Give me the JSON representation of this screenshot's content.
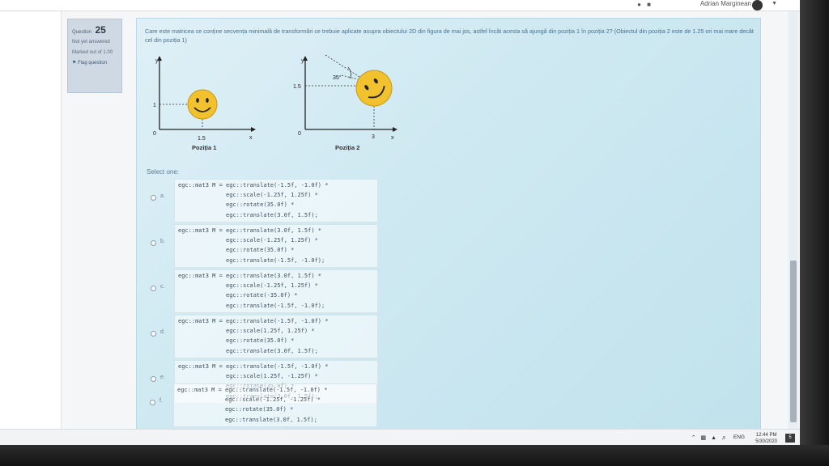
{
  "header": {
    "user_name": "Adrian Marginean"
  },
  "question_info": {
    "label": "Question",
    "number": "25",
    "status": "Not yet answered",
    "marked": "Marked out of 1.00",
    "flag": "Flag question"
  },
  "question": {
    "text": "Care este matricea ce conține secvența minimală de transformări ce trebuie aplicate asupra obiectului 2D din figura de mai jos, astfel încât acesta să ajungă din poziția 1 în poziția 2? (Obiectul din poziția 2 este de 1.25 ori mai mare decât cel din poziția 1)"
  },
  "figure1": {
    "y_axis": "y",
    "x_axis": "x",
    "origin": "0",
    "y_value": "1",
    "x_value": "1.5",
    "caption": "Poziția 1"
  },
  "figure2": {
    "y_axis": "y",
    "x_axis": "x",
    "origin": "0",
    "y_value": "1.5",
    "x_value": "3",
    "angle": "35°",
    "caption": "Poziția 2"
  },
  "select_label": "Select one:",
  "options": [
    {
      "label": "a.",
      "code": "egc::mat3 M = egc::translate(-1.5f, -1.0f) *\n              egc::scale(-1.25f, 1.25f) *\n              egc::rotate(35.0f) *\n              egc::translate(3.0f, 1.5f);"
    },
    {
      "label": "b.",
      "code": "egc::mat3 M = egc::translate(3.0f, 1.5f) *\n              egc::scale(-1.25f, 1.25f) *\n              egc::rotate(35.0f) *\n              egc::translate(-1.5f, -1.0f);"
    },
    {
      "label": "c.",
      "code": "egc::mat3 M = egc::translate(3.0f, 1.5f) *\n              egc::scale(-1.25f, 1.25f) *\n              egc::rotate(-35.0f) *\n              egc::translate(-1.5f, -1.0f);"
    },
    {
      "label": "d.",
      "code": "egc::mat3 M = egc::translate(-1.5f, -1.0f) *\n              egc::scale(1.25f, 1.25f) *\n              egc::rotate(35.0f) *\n              egc::translate(3.0f, 1.5f);"
    },
    {
      "label": "e.",
      "code": "egc::mat3 M = egc::translate(-1.5f, -1.0f) *\n              egc::scale(1.25f, -1.25f) *\n              egc::rotate(35.0f) *\n              egc::translate(3.0f, 1.5f);"
    },
    {
      "label": "f.",
      "code": "egc::mat3 M = egc::translate(-1.5f, -1.0f) *\n              egc::scale(-1.25f, -1.25f) *\n              egc::rotate(35.0f) *\n              egc::translate(3.0f, 1.5f);"
    }
  ],
  "taskbar": {
    "lang": "ENG",
    "time": "12:44 PM",
    "date": "5/30/2020",
    "notif_count": "5"
  },
  "colors": {
    "accent": "#4a6f8c",
    "smiley": "#f2c12e"
  }
}
